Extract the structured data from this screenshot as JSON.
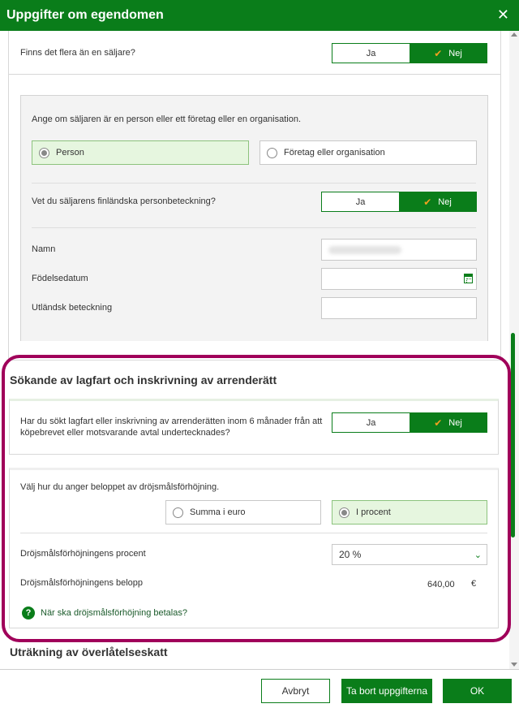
{
  "dialog": {
    "title": "Uppgifter om egendomen"
  },
  "sellers": {
    "multiple_question": "Finns det flera än en säljare?",
    "multiple_yes": "Ja",
    "multiple_no": "Nej",
    "type_prompt": "Ange om säljaren är en person eller ett företag eller en organisation.",
    "option_person": "Person",
    "option_company": "Företag eller organisation",
    "ssn_question": "Vet du säljarens finländska personbeteckning?",
    "ssn_yes": "Ja",
    "ssn_no": "Nej",
    "name_label": "Namn",
    "dob_label": "Födelsedatum",
    "foreign_id_label": "Utländsk beteckning"
  },
  "applicant": {
    "section_title": "Sökande av lagfart och inskrivning av arrenderätt",
    "question": "Har du sökt lagfart eller inskrivning av arrenderätten inom 6 månader från att köpebrevet eller motsvarande avtal undertecknades?",
    "yes": "Ja",
    "no": "Nej",
    "amount_prompt": "Välj hur du anger beloppet av dröjsmålsförhöjning.",
    "option_euro": "Summa i euro",
    "option_percent": "I procent",
    "percent_label": "Dröjsmålsförhöjningens procent",
    "percent_value": "20 %",
    "amount_label": "Dröjsmålsförhöjningens belopp",
    "amount_value": "640,00",
    "currency": "€",
    "help_link": "När ska dröjsmålsförhöjning betalas?"
  },
  "next_section": {
    "title": "Uträkning av överlåtelseskatt"
  },
  "footer": {
    "cancel": "Avbryt",
    "delete": "Ta bort uppgifterna",
    "ok": "OK"
  },
  "colors": {
    "brand": "#0a7d1a",
    "highlight": "#a0005a",
    "selected_bg": "#e6f6df"
  },
  "icons": {
    "close": "close-icon",
    "check": "check-icon",
    "calendar": "calendar-icon",
    "chevron": "chevron-down-icon",
    "help": "help-icon"
  }
}
